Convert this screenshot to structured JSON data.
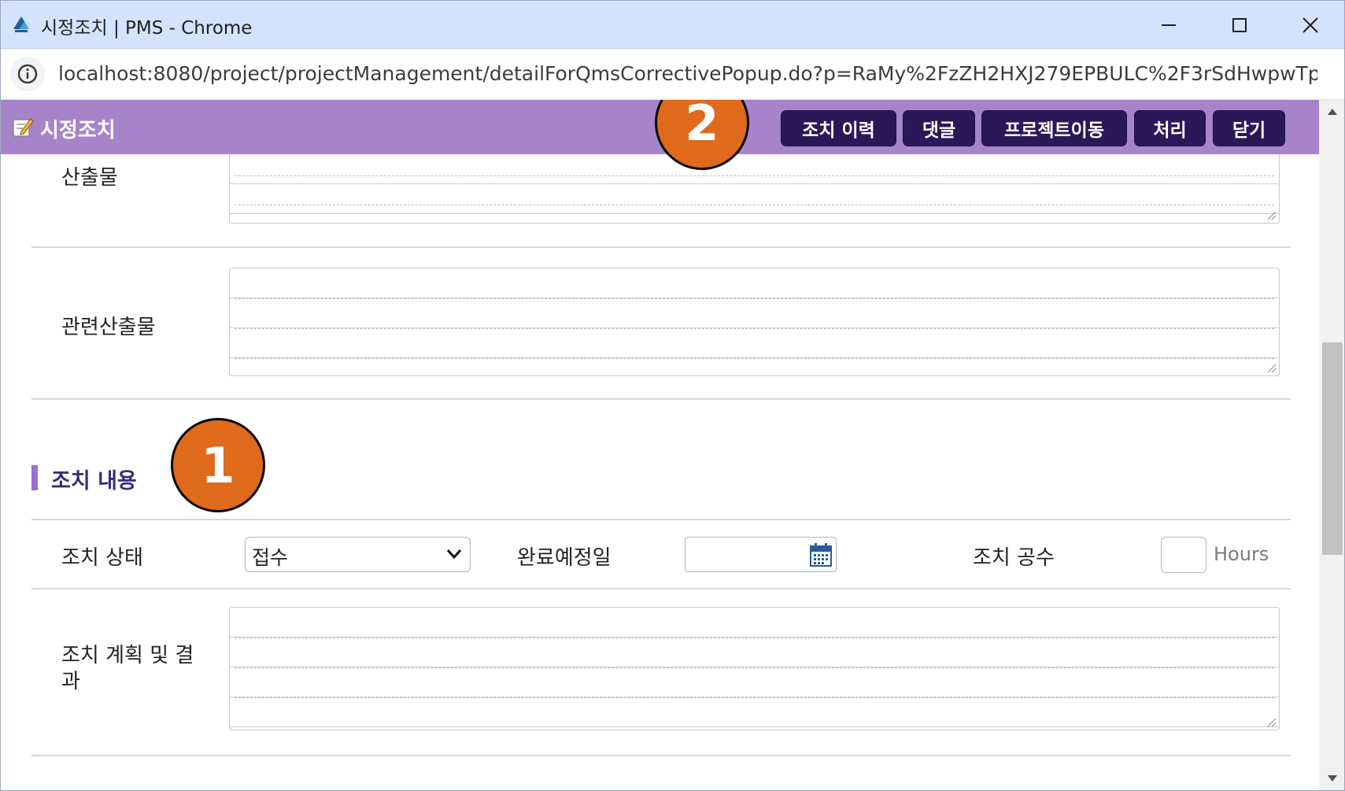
{
  "window": {
    "title": "시정조치 | PMS - Chrome",
    "minimize_icon": "minimize-icon",
    "maximize_icon": "maximize-icon",
    "close_icon": "close-icon"
  },
  "addressbar": {
    "url": "localhost:8080/project/projectManagement/detailForQmsCorrectivePopup.do?p=RaMy%2FzZH2HXJ279EPBULC%2F3rSdHwpwTpz..."
  },
  "popup": {
    "title": "시정조치",
    "buttons": {
      "history": "조치 이력",
      "comment": "댓글",
      "project_move": "프로젝트이동",
      "process": "처리",
      "close": "닫기"
    }
  },
  "form": {
    "output_label": "산출물",
    "related_output_label": "관련산출물",
    "section_title": "조치 내용",
    "status_label": "조치 상태",
    "status_value": "접수",
    "due_date_label": "완료예정일",
    "due_date_value": "",
    "effort_label": "조치 공수",
    "effort_value": "",
    "effort_unit": "Hours",
    "plan_result_label_line1": "조치 계획 및 결",
    "plan_result_label_line2": "과"
  },
  "annotations": {
    "badge1": "1",
    "badge2": "2",
    "color": "#e06a1b"
  },
  "colors": {
    "header": "#a784c9",
    "button": "#2b1858",
    "section_accent": "#9b6fd0"
  }
}
